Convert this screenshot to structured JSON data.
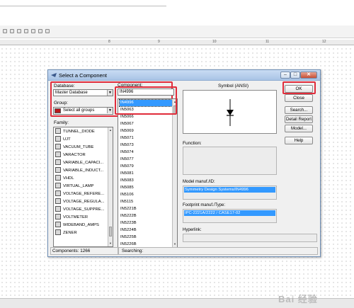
{
  "dialog": {
    "title": "Select a Component",
    "database_label": "Database:",
    "database_value": "Master Database",
    "group_label": "Group:",
    "group_value": "Select all groups",
    "family_label": "Family:",
    "component_label": "Component:",
    "component_value": "IN4996",
    "symbol_label": "Symbol (ANSI)",
    "function_label": "Function:",
    "model_label": "Model manuf./ID:",
    "model_value": "Symmetry Design Systems/IN4996",
    "footprint_label": "Footprint manuf./Type:",
    "footprint_value": "IPC-2221A/2222 / CASE17-02",
    "hyperlink_label": "Hyperlink:",
    "buttons": {
      "ok": "OK",
      "close": "Close",
      "search": "Search...",
      "detail_report": "Detail Report",
      "model": "Model...",
      "help": "Help"
    },
    "status_components": "Components: 1266",
    "status_searching": "Searching:"
  },
  "families": [
    "TUNNEL_DIODE",
    "UJT",
    "VACUUM_TUBE",
    "VARACTOR",
    "VARIABLE_CAPACI...",
    "VARIABLE_INDUCT...",
    "VHDL",
    "VIRTUAL_LAMP",
    "VOLTAGE_REFERE...",
    "VOLTAGE_REGULA...",
    "VOLTAGE_SUPPRE...",
    "VOLTMETER",
    "WIDEBAND_AMPS",
    "ZENER"
  ],
  "components": [
    "IN4996",
    "IN5063",
    "IN5066",
    "IN5067",
    "IN5069",
    "IN5071",
    "IN5073",
    "IN5074",
    "IN5077",
    "IN5079",
    "IN5081",
    "IN5083",
    "IN5085",
    "IN5106",
    "IN5115",
    "IN5221B",
    "IN5222B",
    "IN5223B",
    "IN5224B",
    "IN5225B",
    "IN5226B"
  ],
  "ruler_ticks": [
    "8",
    "9",
    "10",
    "11",
    "12"
  ],
  "watermark": "Bai 经验",
  "colors": {
    "highlight_red": "#e02c3a",
    "selection_blue": "#3399ff"
  }
}
